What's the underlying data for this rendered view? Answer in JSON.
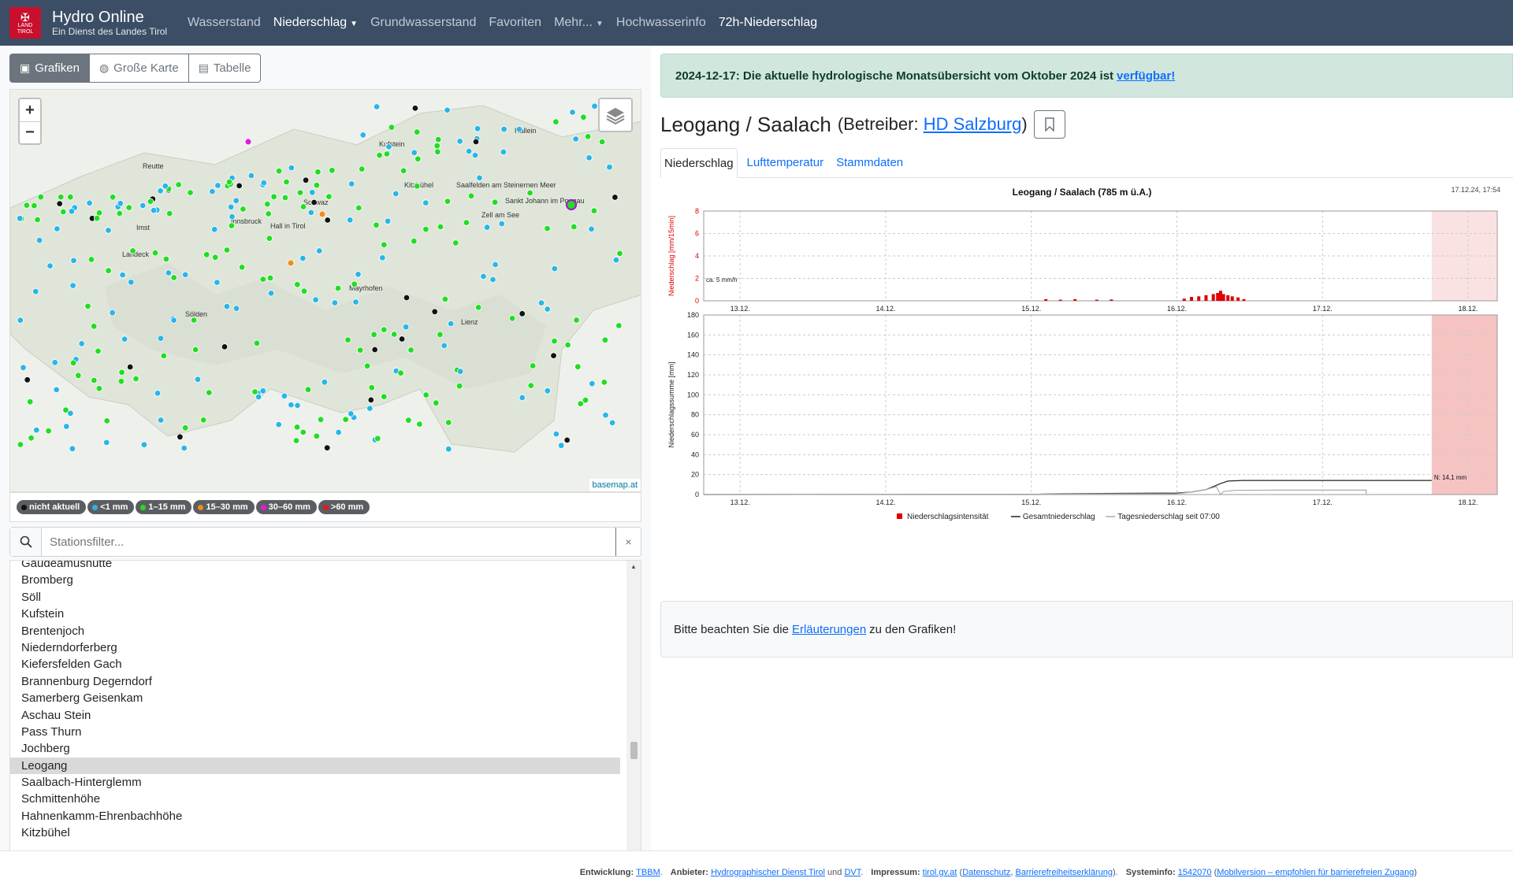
{
  "brand": {
    "title": "Hydro Online",
    "subtitle": "Ein Dienst des Landes Tirol",
    "logo_text": "LAND TIROL"
  },
  "nav": {
    "items": [
      {
        "label": "Wasserstand",
        "active": false
      },
      {
        "label": "Niederschlag",
        "active": true,
        "dropdown": true
      },
      {
        "label": "Grundwasserstand",
        "active": false
      },
      {
        "label": "Favoriten",
        "active": false
      },
      {
        "label": "Mehr...",
        "active": false,
        "dropdown": true
      },
      {
        "label": "Hochwasserinfo",
        "active": false
      },
      {
        "label": "72h-Niederschlag",
        "active": true
      }
    ]
  },
  "view_toggle": {
    "grafiken": "Grafiken",
    "karte": "Große Karte",
    "tabelle": "Tabelle"
  },
  "map": {
    "attribution": "basemap.at",
    "zoom_in": "+",
    "zoom_out": "−",
    "places": [
      {
        "name": "Innsbruck"
      },
      {
        "name": "Kufstein"
      },
      {
        "name": "Kitzbühel"
      },
      {
        "name": "Lienz"
      },
      {
        "name": "Reutte"
      },
      {
        "name": "Landeck"
      },
      {
        "name": "Imst"
      },
      {
        "name": "Schwaz"
      },
      {
        "name": "Zell am See"
      },
      {
        "name": "Saalfelden am Steinernen Meer"
      },
      {
        "name": "Sankt Johann im Pongau"
      },
      {
        "name": "Hall in Tirol"
      },
      {
        "name": "Sölden"
      },
      {
        "name": "Mayrhofen"
      },
      {
        "name": "Hallein"
      }
    ]
  },
  "legend": [
    {
      "label": "nicht aktuell",
      "color": "#111111"
    },
    {
      "label": "<1 mm",
      "color": "#29b6e6"
    },
    {
      "label": "1–15 mm",
      "color": "#22dd22"
    },
    {
      "label": "15–30 mm",
      "color": "#f08c1c"
    },
    {
      "label": "30–60 mm",
      "color": "#e21bd8"
    },
    {
      "label": ">60 mm",
      "color": "#e01b1b"
    }
  ],
  "filter": {
    "placeholder": "Stationsfilter...",
    "clear": "×"
  },
  "stations": [
    "Gaudeamushütte",
    "Bromberg",
    "Söll",
    "Kufstein",
    "Brentenjoch",
    "Niederndorferberg",
    "Kiefersfelden Gach",
    "Brannenburg Degerndorf",
    "Samerberg Geisenkam",
    "Aschau Stein",
    "Pass Thurn",
    "Jochberg",
    "Leogang",
    "Saalbach-Hinterglemm",
    "Schmittenhöhe",
    "Hahnenkamm-Ehrenbachhöhe",
    "Kitzbühel"
  ],
  "selected_station": "Leogang",
  "alert": {
    "text": "2024-12-17: Die aktuelle hydrologische Monatsübersicht vom Oktober 2024 ist",
    "link": "verfügbar!"
  },
  "station": {
    "name": "Leogang / Saalach",
    "operator_prefix": "(Betreiber:",
    "operator": "HD Salzburg",
    "operator_suffix": ")"
  },
  "tabs": [
    {
      "label": "Niederschlag",
      "active": true
    },
    {
      "label": "Lufttemperatur",
      "active": false
    },
    {
      "label": "Stammdaten",
      "active": false
    }
  ],
  "note": {
    "prefix": "Bitte beachten Sie die",
    "link": "Erläuterungen",
    "suffix": "zu den Grafiken!"
  },
  "footer": {
    "entwicklung_label": "Entwicklung:",
    "entwicklung": "TBBM",
    "anbieter_label": "Anbieter:",
    "anbieter1": "Hydrographischer Dienst Tirol",
    "und": "und",
    "anbieter2": "DVT",
    "impressum_label": "Impressum:",
    "impressum": "tirol.gv.at",
    "datenschutz": "Datenschutz",
    "barriere": "Barrierefreiheitserklärung",
    "systeminfo_label": "Systeminfo:",
    "systeminfo": "1542070",
    "mobil": "Mobilversion – empfohlen für barrierefreien Zugang"
  },
  "chart_data": [
    {
      "type": "bar",
      "title": "Leogang / Saalach (785 m ü.A.)",
      "timestamp": "17.12.24, 17:54",
      "ylabel": "Niederschlag [mm/15min]",
      "ylim": [
        0,
        8
      ],
      "yticks": [
        0,
        2,
        4,
        6,
        8
      ],
      "xticks": [
        "13.12.",
        "14.12.",
        "15.12.",
        "16.12.",
        "17.12.",
        "18.12."
      ],
      "x_range_days": [
        12.75,
        18.2
      ],
      "annotation": "ca. 5 mm/h",
      "series": [
        {
          "name": "Niederschlagsintensität",
          "color": "#e00000",
          "points": [
            [
              15.1,
              0.15
            ],
            [
              15.2,
              0.1
            ],
            [
              15.3,
              0.15
            ],
            [
              15.45,
              0.1
            ],
            [
              15.55,
              0.12
            ],
            [
              16.05,
              0.2
            ],
            [
              16.1,
              0.35
            ],
            [
              16.15,
              0.4
            ],
            [
              16.2,
              0.5
            ],
            [
              16.25,
              0.6
            ],
            [
              16.28,
              0.7
            ],
            [
              16.3,
              0.9
            ],
            [
              16.32,
              0.6
            ],
            [
              16.35,
              0.5
            ],
            [
              16.38,
              0.4
            ],
            [
              16.42,
              0.3
            ],
            [
              16.46,
              0.15
            ]
          ]
        }
      ],
      "forecast_from": 17.75
    },
    {
      "type": "line",
      "ylabel": "Niederschlagssumme [mm]",
      "ylim": [
        0,
        180
      ],
      "yticks": [
        0,
        20,
        40,
        60,
        80,
        100,
        120,
        140,
        160,
        180
      ],
      "xticks": [
        "13.12.",
        "14.12.",
        "15.12.",
        "16.12.",
        "17.12.",
        "18.12."
      ],
      "x_range_days": [
        12.75,
        18.2
      ],
      "annotation": "N: 14,1 mm",
      "series": [
        {
          "name": "Gesamtniederschlag",
          "color": "#222222",
          "points": [
            [
              12.75,
              0
            ],
            [
              15.0,
              0.2
            ],
            [
              15.2,
              0.8
            ],
            [
              15.6,
              1.2
            ],
            [
              16.0,
              1.5
            ],
            [
              16.1,
              2.5
            ],
            [
              16.2,
              5
            ],
            [
              16.25,
              8
            ],
            [
              16.3,
              11
            ],
            [
              16.35,
              13.5
            ],
            [
              16.45,
              14.1
            ],
            [
              17.75,
              14.1
            ]
          ]
        },
        {
          "name": "Tagesniederschlag seit 07:00",
          "color": "#aaaaaa",
          "points": [
            [
              12.75,
              0
            ],
            [
              15.0,
              0.2
            ],
            [
              15.2,
              0.6
            ],
            [
              16.0,
              0.8
            ],
            [
              16.1,
              2.5
            ],
            [
              16.2,
              5
            ],
            [
              16.27,
              8
            ],
            [
              16.3,
              0
            ],
            [
              16.32,
              3
            ],
            [
              16.4,
              4.2
            ],
            [
              16.7,
              4.4
            ],
            [
              17.3,
              4.5
            ],
            [
              17.3,
              0
            ],
            [
              17.75,
              0
            ]
          ]
        }
      ],
      "forecast_from": 17.75
    }
  ]
}
